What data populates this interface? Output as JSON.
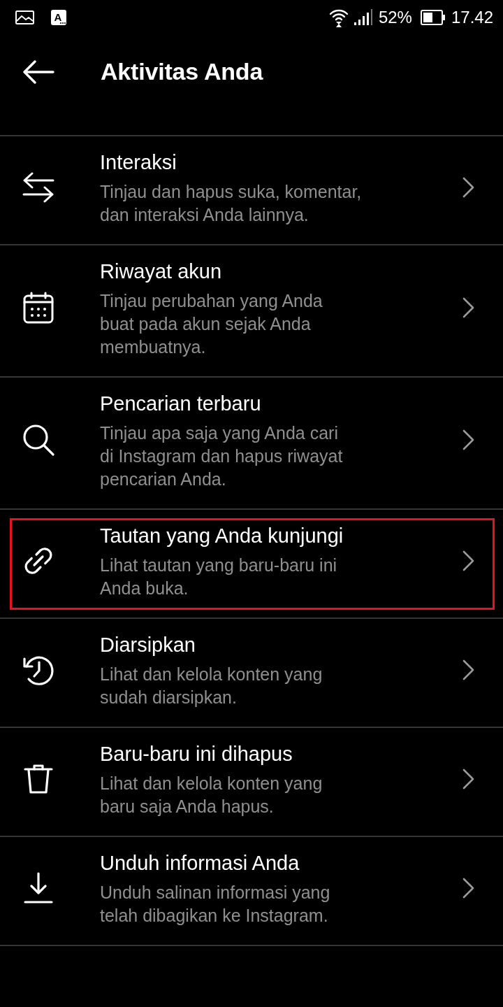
{
  "status_bar": {
    "notification_letter": "A",
    "battery_percent": "52%",
    "time": "17.42"
  },
  "header": {
    "title": "Aktivitas Anda"
  },
  "items": [
    {
      "title": "Interaksi",
      "description": "Tinjau dan hapus suka, komentar,\ndan interaksi Anda lainnya.",
      "highlighted": false
    },
    {
      "title": "Riwayat akun",
      "description": "Tinjau perubahan yang Anda\nbuat pada akun sejak Anda\nmembuatnya.",
      "highlighted": false
    },
    {
      "title": "Pencarian terbaru",
      "description": "Tinjau apa saja yang Anda cari\ndi Instagram dan hapus riwayat\npencarian Anda.",
      "highlighted": false
    },
    {
      "title": "Tautan yang Anda kunjungi",
      "description": "Lihat tautan yang baru-baru ini\nAnda buka.",
      "highlighted": true
    },
    {
      "title": "Diarsipkan",
      "description": "Lihat dan kelola konten yang\nsudah diarsipkan.",
      "highlighted": false
    },
    {
      "title": "Baru-baru ini dihapus",
      "description": "Lihat dan kelola konten yang\nbaru saja Anda hapus.",
      "highlighted": false
    },
    {
      "title": "Unduh informasi Anda",
      "description": "Unduh salinan informasi yang\ntelah dibagikan ke Instagram.",
      "highlighted": false
    }
  ]
}
